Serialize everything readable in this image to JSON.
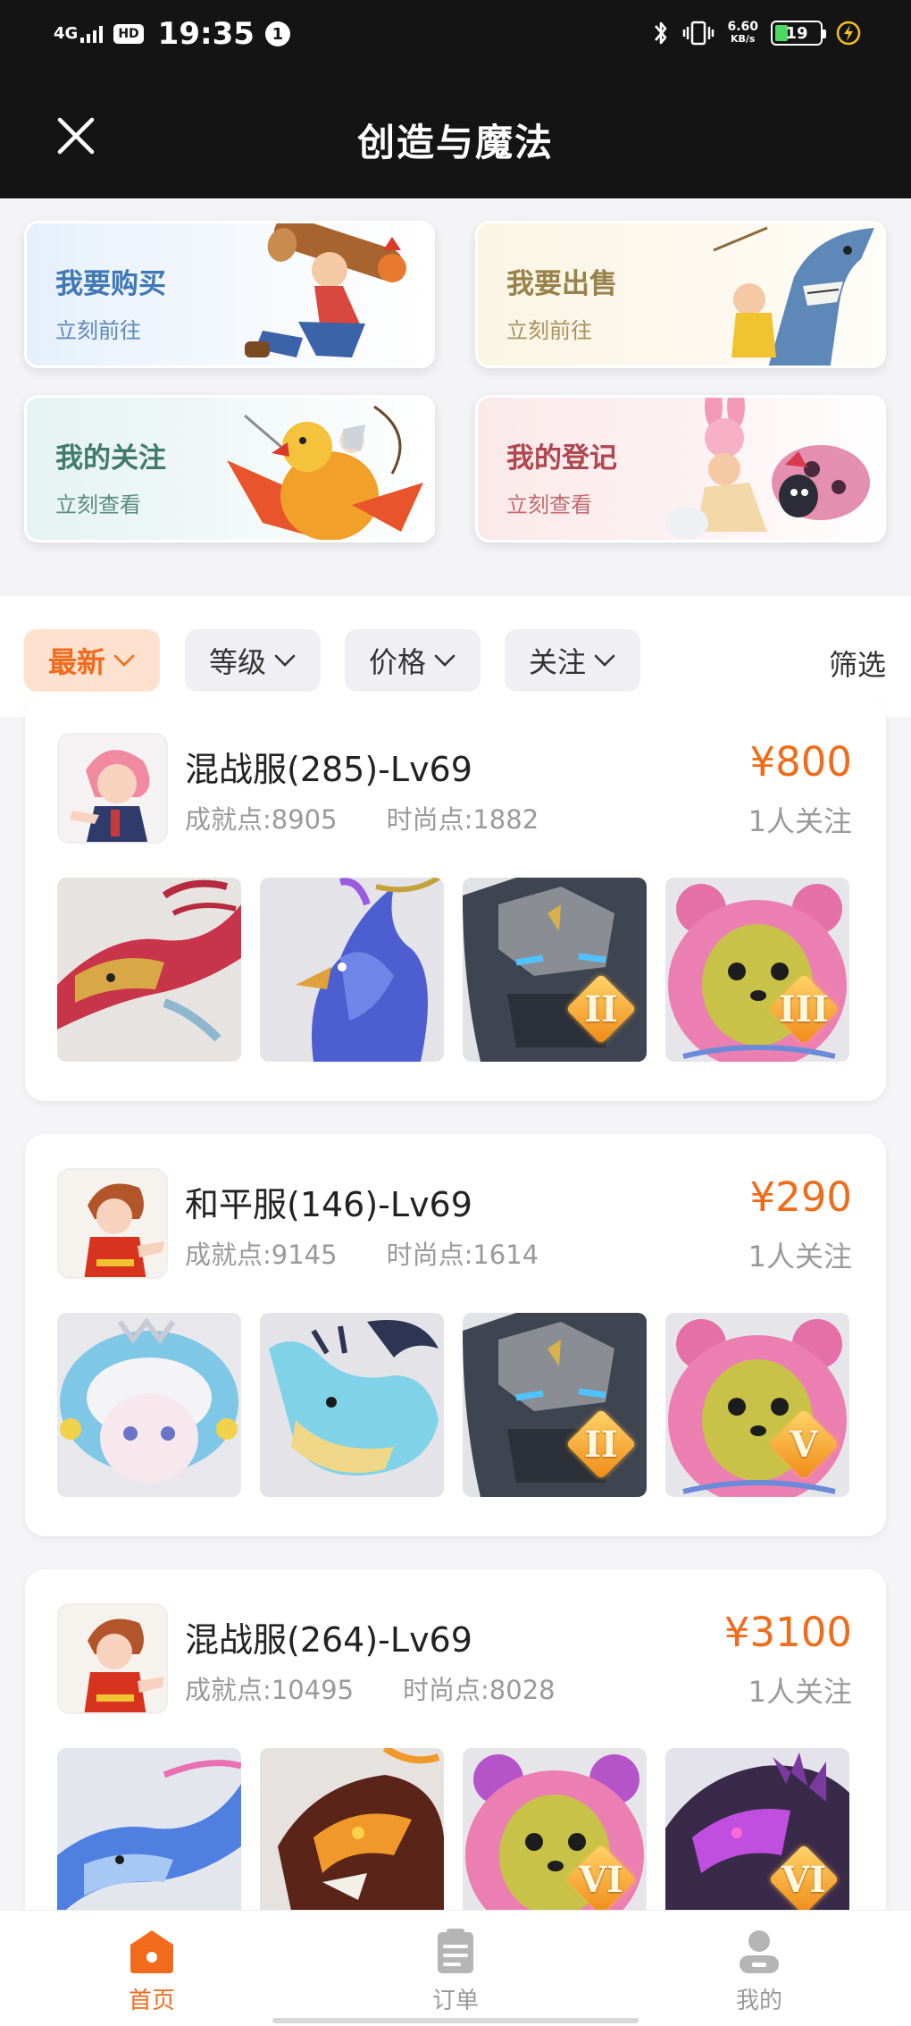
{
  "status_bar": {
    "network": "4G",
    "hd": "HD",
    "time": "19:35",
    "notification_count": "1",
    "speed_value": "6.60",
    "speed_unit": "KB/s",
    "battery": "19"
  },
  "header": {
    "title": "创造与魔法",
    "close_icon": "close-icon"
  },
  "quick_actions": [
    {
      "title": "我要购买",
      "subtitle": "立刻前往",
      "icon": "buy-art"
    },
    {
      "title": "我要出售",
      "subtitle": "立刻前往",
      "icon": "sell-art"
    },
    {
      "title": "我的关注",
      "subtitle": "立刻查看",
      "icon": "follow-art"
    },
    {
      "title": "我的登记",
      "subtitle": "立刻查看",
      "icon": "register-art"
    }
  ],
  "filters": {
    "chips": [
      {
        "label": "最新",
        "active": true
      },
      {
        "label": "等级",
        "active": false
      },
      {
        "label": "价格",
        "active": false
      },
      {
        "label": "关注",
        "active": false
      }
    ],
    "filter_link": "筛选"
  },
  "listings": [
    {
      "name": "混战服(285)-Lv69",
      "achievement": "成就点:8905",
      "fashion": "时尚点:1882",
      "price": "¥800",
      "followers": "1人关注",
      "items": [
        {
          "icon": "red-dragon-mount",
          "tier": ""
        },
        {
          "icon": "blue-phoenix-mount",
          "tier": ""
        },
        {
          "icon": "rock-golem-mount",
          "tier": "II"
        },
        {
          "icon": "pink-bear-mount",
          "tier": "III"
        }
      ]
    },
    {
      "name": "和平服(146)-Lv69",
      "achievement": "成就点:9145",
      "fashion": "时尚点:1614",
      "price": "¥290",
      "followers": "1人关注",
      "items": [
        {
          "icon": "cloud-doll-mount",
          "tier": ""
        },
        {
          "icon": "ice-dragon-mount",
          "tier": ""
        },
        {
          "icon": "rock-golem-mount",
          "tier": "II"
        },
        {
          "icon": "pink-bear-mount",
          "tier": "V"
        }
      ]
    },
    {
      "name": "混战服(264)-Lv69",
      "achievement": "成就点:10495",
      "fashion": "时尚点:8028",
      "price": "¥3100",
      "followers": "1人关注",
      "items": [
        {
          "icon": "azure-dragon-mount",
          "tier": ""
        },
        {
          "icon": "lava-dragon-mount",
          "tier": ""
        },
        {
          "icon": "pink-bear-mount",
          "tier": "VI"
        },
        {
          "icon": "shadow-beast-mount",
          "tier": "VI"
        }
      ]
    }
  ],
  "bottom_nav": [
    {
      "label": "首页",
      "active": true
    },
    {
      "label": "订单",
      "active": false
    },
    {
      "label": "我的",
      "active": false
    }
  ],
  "colors": {
    "accent": "#f26a1b",
    "price": "#ef6c1a",
    "header_bg": "#141414"
  }
}
